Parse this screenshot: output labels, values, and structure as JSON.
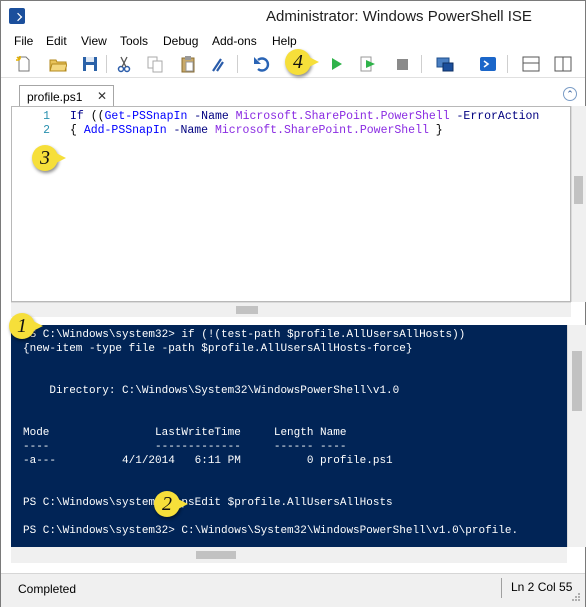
{
  "window": {
    "title": "Administrator: Windows PowerShell ISE"
  },
  "menu": [
    "File",
    "Edit",
    "View",
    "Tools",
    "Debug",
    "Add-ons",
    "Help"
  ],
  "toolbar": {
    "icons": [
      "new-file-icon",
      "open-folder-icon",
      "save-icon",
      "cut-icon",
      "copy-icon",
      "paste-icon",
      "clear-console-icon",
      "undo-icon",
      "run-script-icon",
      "run-selection-icon",
      "stop-icon",
      "remote-powershell-icon",
      "powershell-console-icon",
      "show-script-pane-top-icon",
      "show-script-pane-right-icon"
    ],
    "colors": {
      "run": "#2fb34a",
      "undo": "#2a64b5",
      "stop": "#8a8a8a"
    }
  },
  "tabs": [
    {
      "label": "profile.ps1",
      "close": "✕"
    }
  ],
  "collapse_glyph": "⌃",
  "editor": {
    "lines": [
      {
        "num": "1",
        "tokens": [
          {
            "t": "If ",
            "c": "kw"
          },
          {
            "t": "((",
            "c": "pl"
          },
          {
            "t": "Get-PSSnapIn",
            "c": "cmd"
          },
          {
            "t": " -Name ",
            "c": "prm"
          },
          {
            "t": "Microsoft.SharePoint.PowerShell",
            "c": "typ"
          },
          {
            "t": " -ErrorAction",
            "c": "prm"
          }
        ]
      },
      {
        "num": "2",
        "tokens": [
          {
            "t": "{ ",
            "c": "pl"
          },
          {
            "t": "Add-PSSnapIn",
            "c": "cmd"
          },
          {
            "t": " -Name ",
            "c": "prm"
          },
          {
            "t": "Microsoft.SharePoint.PowerShell",
            "c": "typ"
          },
          {
            "t": " }",
            "c": "pl"
          }
        ]
      }
    ]
  },
  "console": {
    "lines": [
      "PS C:\\Windows\\system32> if (!(test-path $profile.AllUsersAllHosts))",
      "{new-item -type file -path $profile.AllUsersAllHosts-force}",
      "",
      "",
      "    Directory: C:\\Windows\\System32\\WindowsPowerShell\\v1.0",
      "",
      "",
      "Mode                LastWriteTime     Length Name",
      "----                -------------     ------ ----",
      "-a---          4/1/2014   6:11 PM          0 profile.ps1",
      "",
      "",
      "PS C:\\Windows\\system32> psEdit $profile.AllUsersAllHosts",
      "",
      "PS C:\\Windows\\system32> C:\\Windows\\System32\\WindowsPowerShell\\v1.0\\profile."
    ],
    "colors": {
      "background": "#012456",
      "text": "#ffffff"
    }
  },
  "callouts": {
    "c1": "1",
    "c2": "2",
    "c3": "3",
    "c4": "4"
  },
  "status": {
    "text": "Completed",
    "position": "Ln 2  Col 55"
  }
}
